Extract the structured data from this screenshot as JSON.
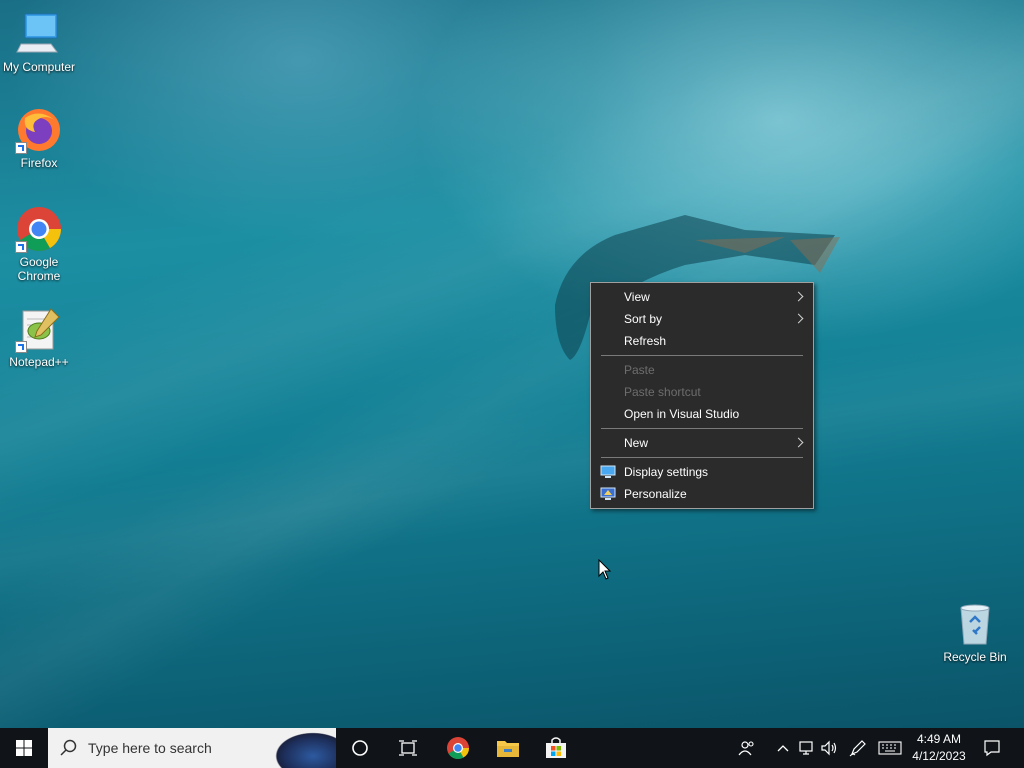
{
  "desktop": {
    "icons": [
      {
        "label": "My Computer"
      },
      {
        "label": "Firefox"
      },
      {
        "label": "Google Chrome"
      },
      {
        "label": "Notepad++"
      },
      {
        "label": "Recycle Bin"
      }
    ]
  },
  "context_menu": {
    "items": [
      {
        "label": "View",
        "submenu": true,
        "enabled": true
      },
      {
        "label": "Sort by",
        "submenu": true,
        "enabled": true
      },
      {
        "label": "Refresh",
        "enabled": true
      },
      {
        "label": "Paste",
        "enabled": false
      },
      {
        "label": "Paste shortcut",
        "enabled": false
      },
      {
        "label": "Open in Visual Studio",
        "enabled": true
      },
      {
        "label": "New",
        "submenu": true,
        "enabled": true
      },
      {
        "label": "Display settings",
        "icon": "display-icon",
        "enabled": true
      },
      {
        "label": "Personalize",
        "icon": "personalize-icon",
        "enabled": true
      }
    ]
  },
  "taskbar": {
    "search_placeholder": "Type here to search",
    "pinned": [
      "cortana-icon",
      "task-view-icon",
      "chrome-icon",
      "file-explorer-icon",
      "microsoft-store-icon"
    ],
    "tray_icons": [
      "people-icon",
      "chevron-up-icon",
      "network-icon",
      "volume-icon",
      "pen-icon",
      "keyboard-icon"
    ],
    "clock": {
      "time": "4:49 AM",
      "date": "4/12/2023"
    }
  },
  "colors": {
    "menu_bg": "#2b2b2b",
    "taskbar_bg": "#101418",
    "accent": "#0078d7"
  }
}
